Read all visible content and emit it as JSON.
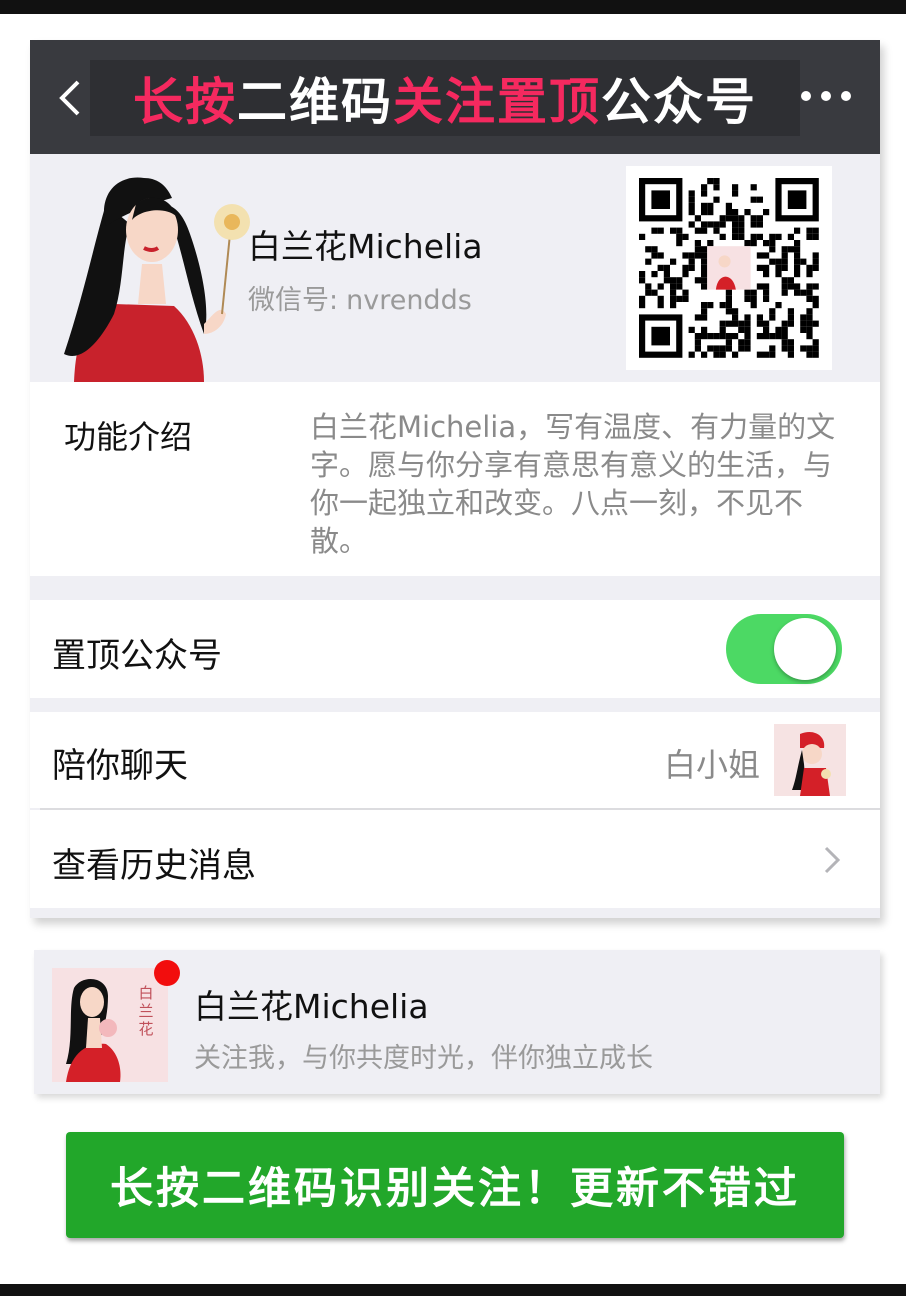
{
  "navbar": {
    "title_parts": [
      {
        "text": "长按",
        "color": "red"
      },
      {
        "text": "二维码",
        "color": "white"
      },
      {
        "text": "关注置顶",
        "color": "red"
      },
      {
        "text": "公众号",
        "color": "white"
      }
    ],
    "back_icon": "chevron-left-icon",
    "more_icon": "more-dots-icon"
  },
  "profile": {
    "name": "白兰花Michelia",
    "wechat_label": "微信号:",
    "wechat_id": "nvrendds"
  },
  "intro": {
    "label": "功能介绍",
    "text": "白兰花Michelia，写有温度、有力量的文字。愿与你分享有意思有意义的生活，与你一起独立和改变。八点一刻，不见不散。"
  },
  "pin_row": {
    "label": "置顶公众号",
    "enabled": true
  },
  "chat_row": {
    "label": "陪你聊天",
    "value": "白小姐"
  },
  "history_row": {
    "label": "查看历史消息"
  },
  "message_card": {
    "title": "白兰花Michelia",
    "subtitle": "关注我，与你共度时光，伴你独立成长",
    "logo_text": "白兰花",
    "unread": true
  },
  "cta": {
    "label": "长按二维码识别关注！更新不错过"
  },
  "colors": {
    "navbar_bg": "#393a3f",
    "accent_red": "#f5295f",
    "toggle_on": "#4cd964",
    "cta_green": "#22a72a",
    "unread_dot": "#f20d0d"
  }
}
